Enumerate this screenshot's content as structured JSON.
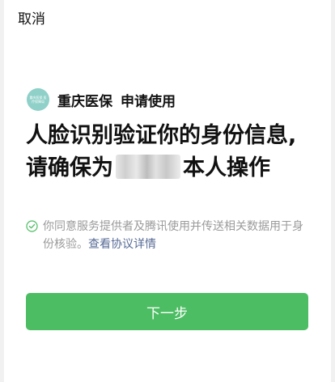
{
  "header": {
    "cancel_label": "取消"
  },
  "app": {
    "logo_text": "重庆医保 医疗保障局",
    "name": "重庆医保",
    "action": "申请使用"
  },
  "headline": {
    "line1": "人脸识别验证你的身份信息,",
    "line2_prefix": "请确保为",
    "line2_suffix": "本人操作"
  },
  "consent": {
    "text": "你同意服务提供者及腾讯使用并传送相关数据用于身份核验。",
    "link_label": "查看协议详情"
  },
  "footer": {
    "next_label": "下一步"
  },
  "colors": {
    "accent_green": "#4cbd63",
    "link_blue": "#576b95",
    "muted_text": "#9a9a9a"
  },
  "icons": {
    "consent_check": "check-circle-icon",
    "app_logo": "chongqing-medical-insurance-logo"
  }
}
